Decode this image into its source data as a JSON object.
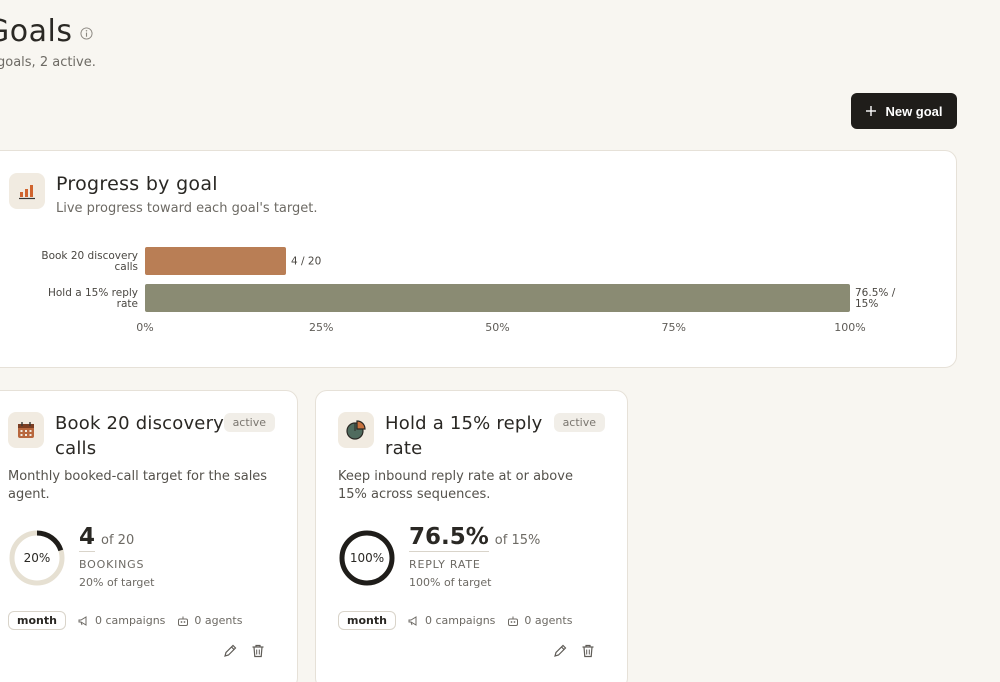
{
  "header": {
    "title": "Goals",
    "subtitle": "goals, 2 active.",
    "new_goal_label": "New goal"
  },
  "progress_card": {
    "title": "Progress by goal",
    "subtitle": "Live progress toward each goal's target."
  },
  "chart_data": {
    "type": "bar",
    "orientation": "horizontal",
    "categories": [
      "Book 20 discovery calls",
      "Hold a 15% reply rate"
    ],
    "values": [
      20,
      100
    ],
    "value_labels": [
      "4 / 20",
      "76.5% / 15%"
    ],
    "bar_colors": [
      "#b97e55",
      "#8a8b73"
    ],
    "x_ticks": [
      "0%",
      "25%",
      "50%",
      "75%",
      "100%"
    ],
    "xlim": [
      0,
      100
    ],
    "grid": false
  },
  "goals": [
    {
      "title": "Book 20 discovery calls",
      "status": "active",
      "description": "Monthly booked-call target for the sales agent.",
      "ring_text": "20%",
      "ring_fraction": 0.2,
      "value": "4",
      "of_text": "of 20",
      "metric_label": "BOOKINGS",
      "pct_text": "20% of target",
      "period": "month",
      "campaigns": "0 campaigns",
      "agents": "0 agents",
      "icon": "calendar-icon"
    },
    {
      "title": "Hold a 15% reply rate",
      "status": "active",
      "description": "Keep inbound reply rate at or above 15% across sequences.",
      "ring_text": "100%",
      "ring_fraction": 1.0,
      "value": "76.5%",
      "of_text": "of 15%",
      "metric_label": "REPLY RATE",
      "pct_text": "100% of target",
      "period": "month",
      "campaigns": "0 campaigns",
      "agents": "0 agents",
      "icon": "pie-chart-icon"
    }
  ],
  "colors": {
    "accent_orange": "#b97e55",
    "accent_olive": "#8a8b73",
    "ring_track": "#e6e0d2",
    "ring_fill": "#1f1d1a",
    "button_dark": "#1f1d1a"
  }
}
